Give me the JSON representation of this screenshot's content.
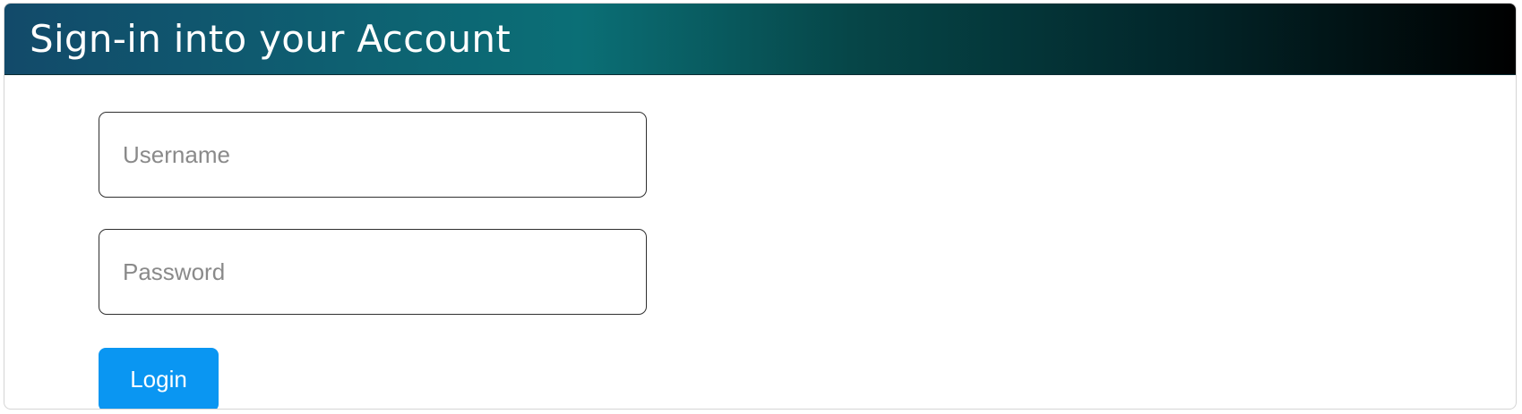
{
  "header": {
    "title": "Sign-in into your Account"
  },
  "form": {
    "username": {
      "value": "",
      "placeholder": "Username"
    },
    "password": {
      "value": "",
      "placeholder": "Password"
    },
    "login_label": "Login"
  },
  "colors": {
    "header_gradient_start": "#124a6a",
    "header_gradient_mid": "#0b6f76",
    "header_gradient_end": "#000000",
    "login_button": "#0a96f2",
    "input_border": "#2f2f2f",
    "placeholder_text": "#8a8a8a"
  }
}
